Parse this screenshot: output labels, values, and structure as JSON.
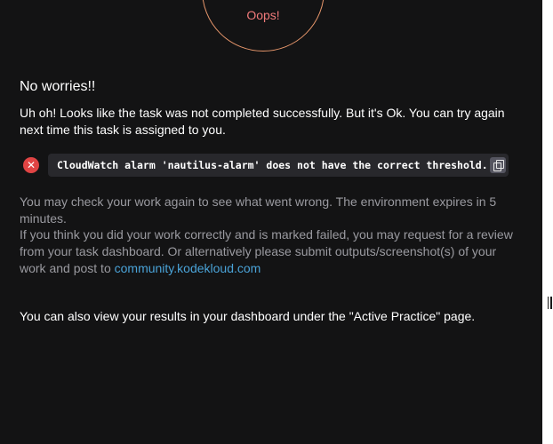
{
  "result": {
    "badge_text": "Oops!",
    "heading": "No worries!!",
    "intro": "Uh oh! Looks like the task was not completed successfully. But it's Ok. You can try again next time this task is assigned to you.",
    "error_message": "CloudWatch alarm 'nautilus-alarm' does not have the correct threshold.",
    "status_icon": "close-icon",
    "copy_icon": "copy-icon"
  },
  "help": {
    "check_text": "You may check your work again to see what went wrong. The environment expires in 5 minutes.",
    "review_text": "If you think you did your work correctly and is marked failed, you may request for a review from your task dashboard. Or alternatively please submit outputs/screenshot(s) of your work and post to ",
    "community_link": "community.kodekloud.com",
    "dashboard_note": "You can also view your results in your dashboard under the \"Active Practice\" page."
  },
  "colors": {
    "background": "#131314",
    "ring": "#e6966b",
    "oops": "#f07a7a",
    "error": "#e04444",
    "link": "#4aa3d8"
  }
}
